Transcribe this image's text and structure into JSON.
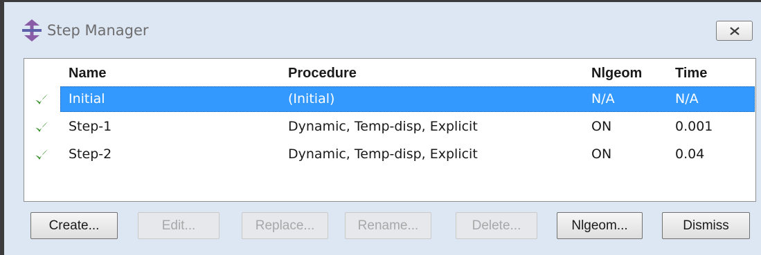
{
  "window": {
    "title": "Step Manager",
    "close_label": "×"
  },
  "table": {
    "columns": [
      "Name",
      "Procedure",
      "Nlgeom",
      "Time"
    ],
    "rows": [
      {
        "name": "Initial",
        "procedure": "(Initial)",
        "nlgeom": "N/A",
        "time": "N/A",
        "selected": true,
        "status": "check-icon"
      },
      {
        "name": "Step-1",
        "procedure": "Dynamic, Temp-disp, Explicit",
        "nlgeom": "ON",
        "time": "0.001",
        "selected": false,
        "status": "check-icon"
      },
      {
        "name": "Step-2",
        "procedure": "Dynamic, Temp-disp, Explicit",
        "nlgeom": "ON",
        "time": "0.04",
        "selected": false,
        "status": "check-icon"
      }
    ]
  },
  "buttons": {
    "create": "Create...",
    "edit": "Edit...",
    "replace": "Replace...",
    "rename": "Rename...",
    "delete": "Delete...",
    "nlgeom": "Nlgeom...",
    "dismiss": "Dismiss"
  },
  "colors": {
    "selection": "#3399ff",
    "check": "#2e8b20",
    "dialog_bg": "#dde6f3"
  }
}
